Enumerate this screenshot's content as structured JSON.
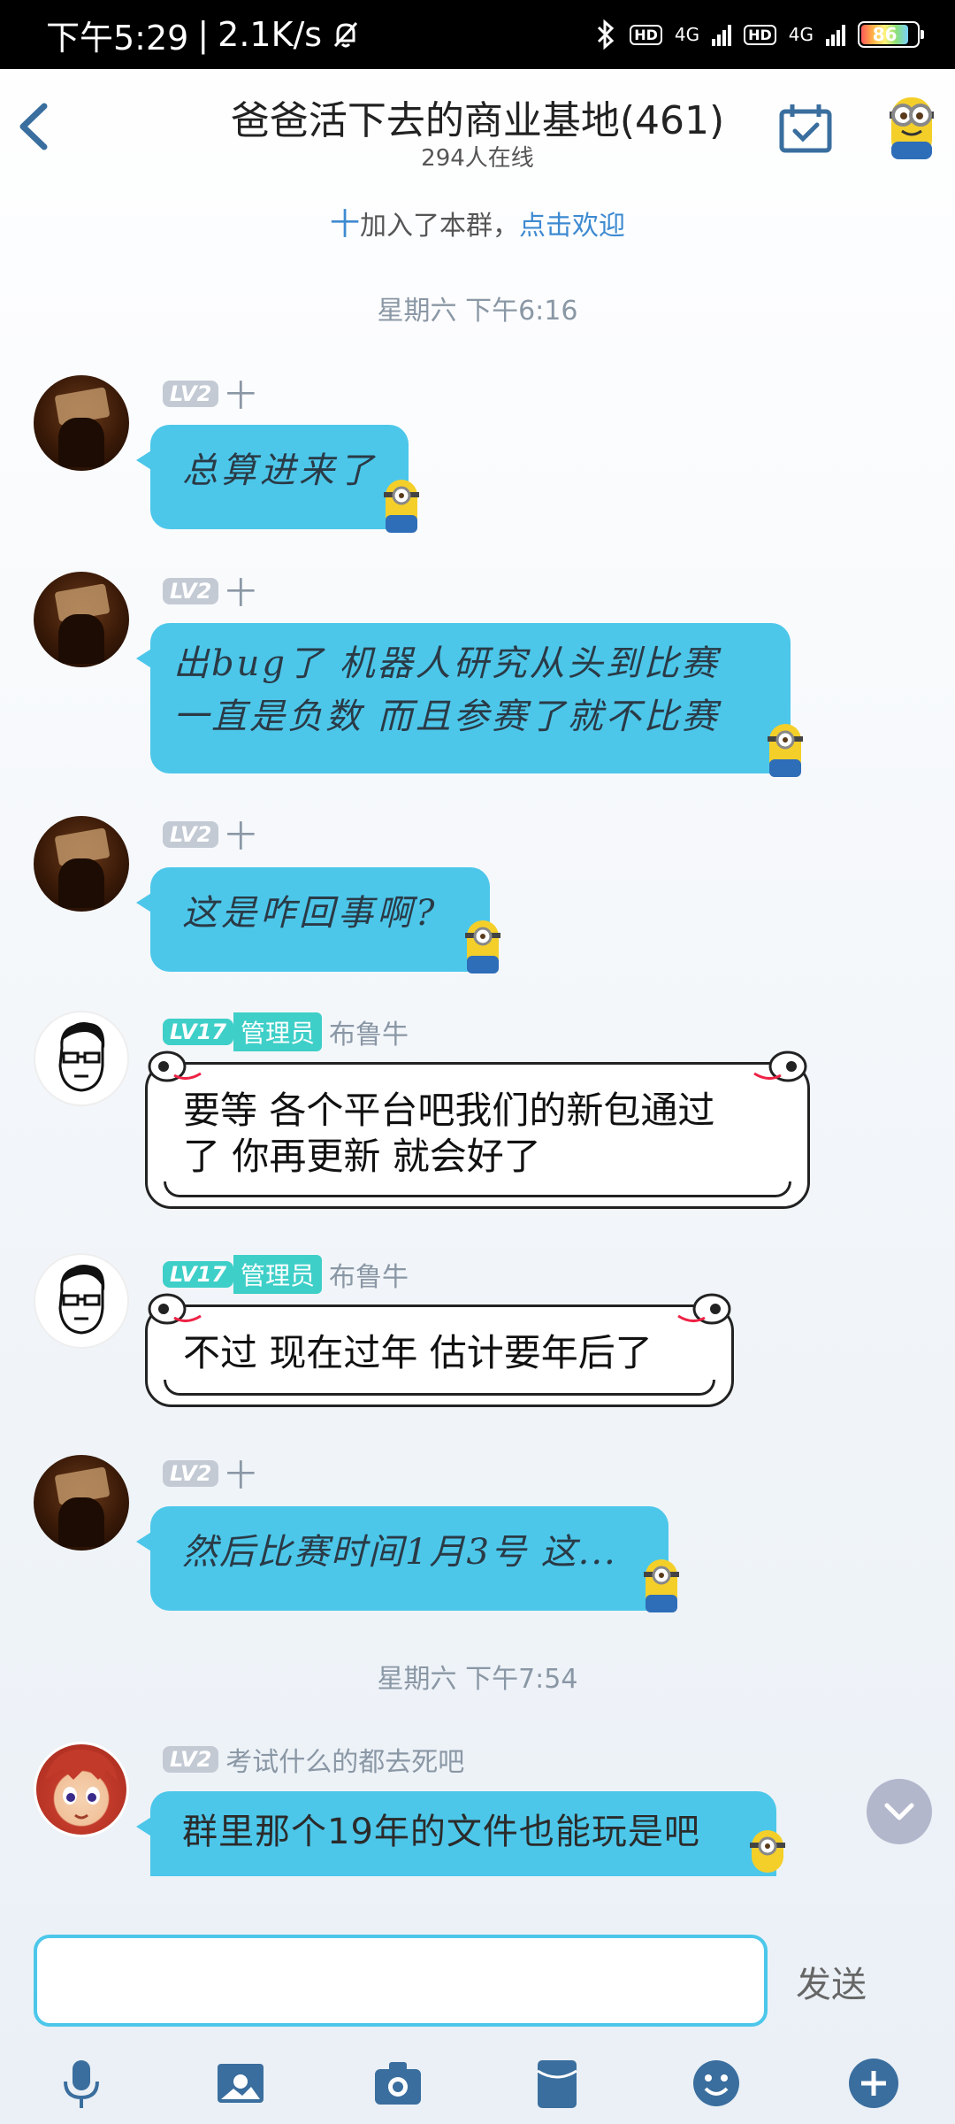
{
  "status_bar": {
    "time": "下午5:29",
    "separator": "|",
    "speed": "2.1K/s",
    "hd1": "HD",
    "net1": "4G",
    "hd2": "HD",
    "net2": "4G",
    "battery": "86"
  },
  "header": {
    "title": "爸爸活下去的商业基地(461)",
    "online_count": "294人在线"
  },
  "join_notice": {
    "plus": "十",
    "text": "加入了本群，",
    "link": "点击欢迎"
  },
  "timestamps": [
    "星期六 下午6:16",
    "星期六 下午7:54"
  ],
  "messages": [
    {
      "level": "LV2",
      "name_glyph": "十",
      "text": "总算进来了"
    },
    {
      "level": "LV2",
      "name_glyph": "十",
      "line1": "出bug了 机器人研究从头到比赛",
      "line2": "一直是负数 而且参赛了就不比赛"
    },
    {
      "level": "LV2",
      "name_glyph": "十",
      "text": "这是咋回事啊?"
    },
    {
      "level": "LV17",
      "role": "管理员",
      "name": "布鲁牛",
      "line1": "要等 各个平台吧我们的新包通过",
      "line2": "了 你再更新 就会好了"
    },
    {
      "level": "LV17",
      "role": "管理员",
      "name": "布鲁牛",
      "text": "不过 现在过年 估计要年后了"
    },
    {
      "level": "LV2",
      "name_glyph": "十",
      "text": "然后比赛时间1月3号 这..."
    },
    {
      "level": "LV2",
      "name": "考试什么的都去死吧",
      "text": "群里那个19年的文件也能玩是吧"
    }
  ],
  "input": {
    "value": "",
    "send_label": "发送"
  },
  "colors": {
    "bubble": "#4cc7ea",
    "accent": "#3d8ad1",
    "admin": "#3ecfc8"
  },
  "toolbar_icons": [
    "microphone-icon",
    "image-icon",
    "camera-icon",
    "red-packet-icon",
    "emoji-icon",
    "plus-icon"
  ]
}
